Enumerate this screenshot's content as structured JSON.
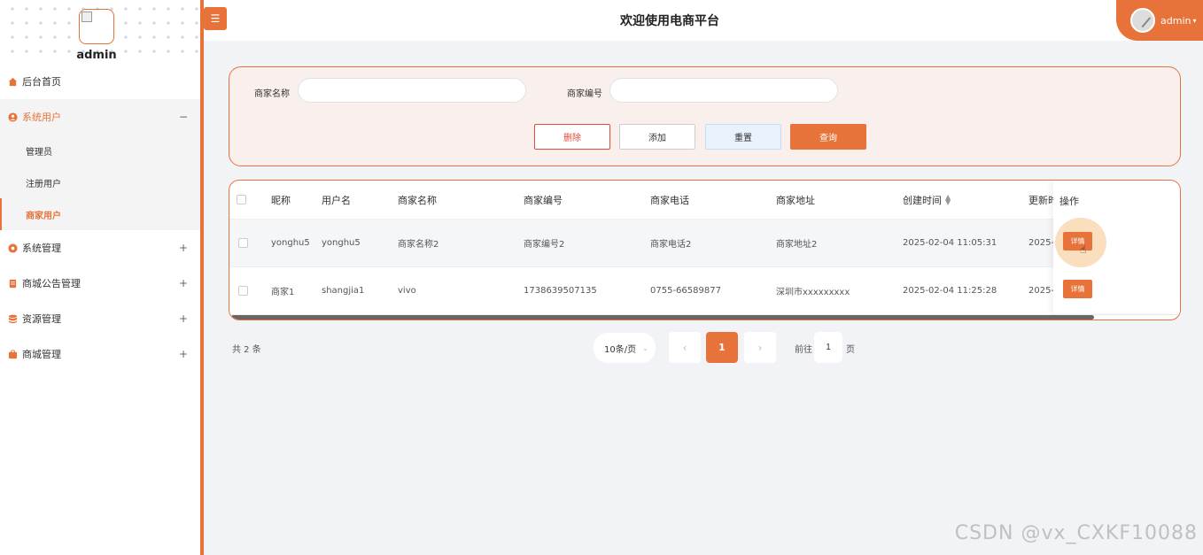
{
  "sidebar": {
    "admin_name": "admin",
    "menu": [
      {
        "label": "后台首页",
        "icon": "home-icon",
        "toggle": ""
      },
      {
        "label": "系统用户",
        "icon": "user-circle-icon",
        "toggle": "−"
      },
      {
        "label": "系统管理",
        "icon": "gear-icon",
        "toggle": "+"
      },
      {
        "label": "商城公告管理",
        "icon": "notice-icon",
        "toggle": "+"
      },
      {
        "label": "资源管理",
        "icon": "database-icon",
        "toggle": "+"
      },
      {
        "label": "商城管理",
        "icon": "shop-icon",
        "toggle": "+"
      }
    ],
    "submenu": [
      "管理员",
      "注册用户",
      "商家用户"
    ]
  },
  "header": {
    "title": "欢迎使用电商平台",
    "user": "admin"
  },
  "search": {
    "merchant_name_label": "商家名称",
    "merchant_name_value": "",
    "merchant_code_label": "商家编号",
    "merchant_code_value": "",
    "delete": "删除",
    "add": "添加",
    "reset": "重置",
    "query": "查询"
  },
  "table": {
    "columns": [
      "昵称",
      "用户名",
      "商家名称",
      "商家编号",
      "商家电话",
      "商家地址",
      "创建时间",
      "更新时间"
    ],
    "op_header": "操作",
    "detail": "详情",
    "rows": [
      {
        "nick": "yonghu5",
        "username": "yonghu5",
        "name": "商家名称2",
        "code": "商家编号2",
        "phone": "商家电话2",
        "address": "商家地址2",
        "created": "2025-02-04 11:05:31",
        "updated": "2025-"
      },
      {
        "nick": "商家1",
        "username": "shangjia1",
        "name": "vivo",
        "code": "1738639507135",
        "phone": "0755-66589877",
        "address": "深圳市xxxxxxxxx",
        "created": "2025-02-04 11:25:28",
        "updated": "2025-"
      }
    ]
  },
  "pagination": {
    "total": "共 2 条",
    "page_size": "10条/页",
    "current": "1",
    "goto_label": "前往",
    "goto_value": "1",
    "goto_unit": "页"
  },
  "watermark": "CSDN @vx_CXKF10088",
  "colors": {
    "accent": "#e8733a",
    "danger": "#e04b3a"
  }
}
